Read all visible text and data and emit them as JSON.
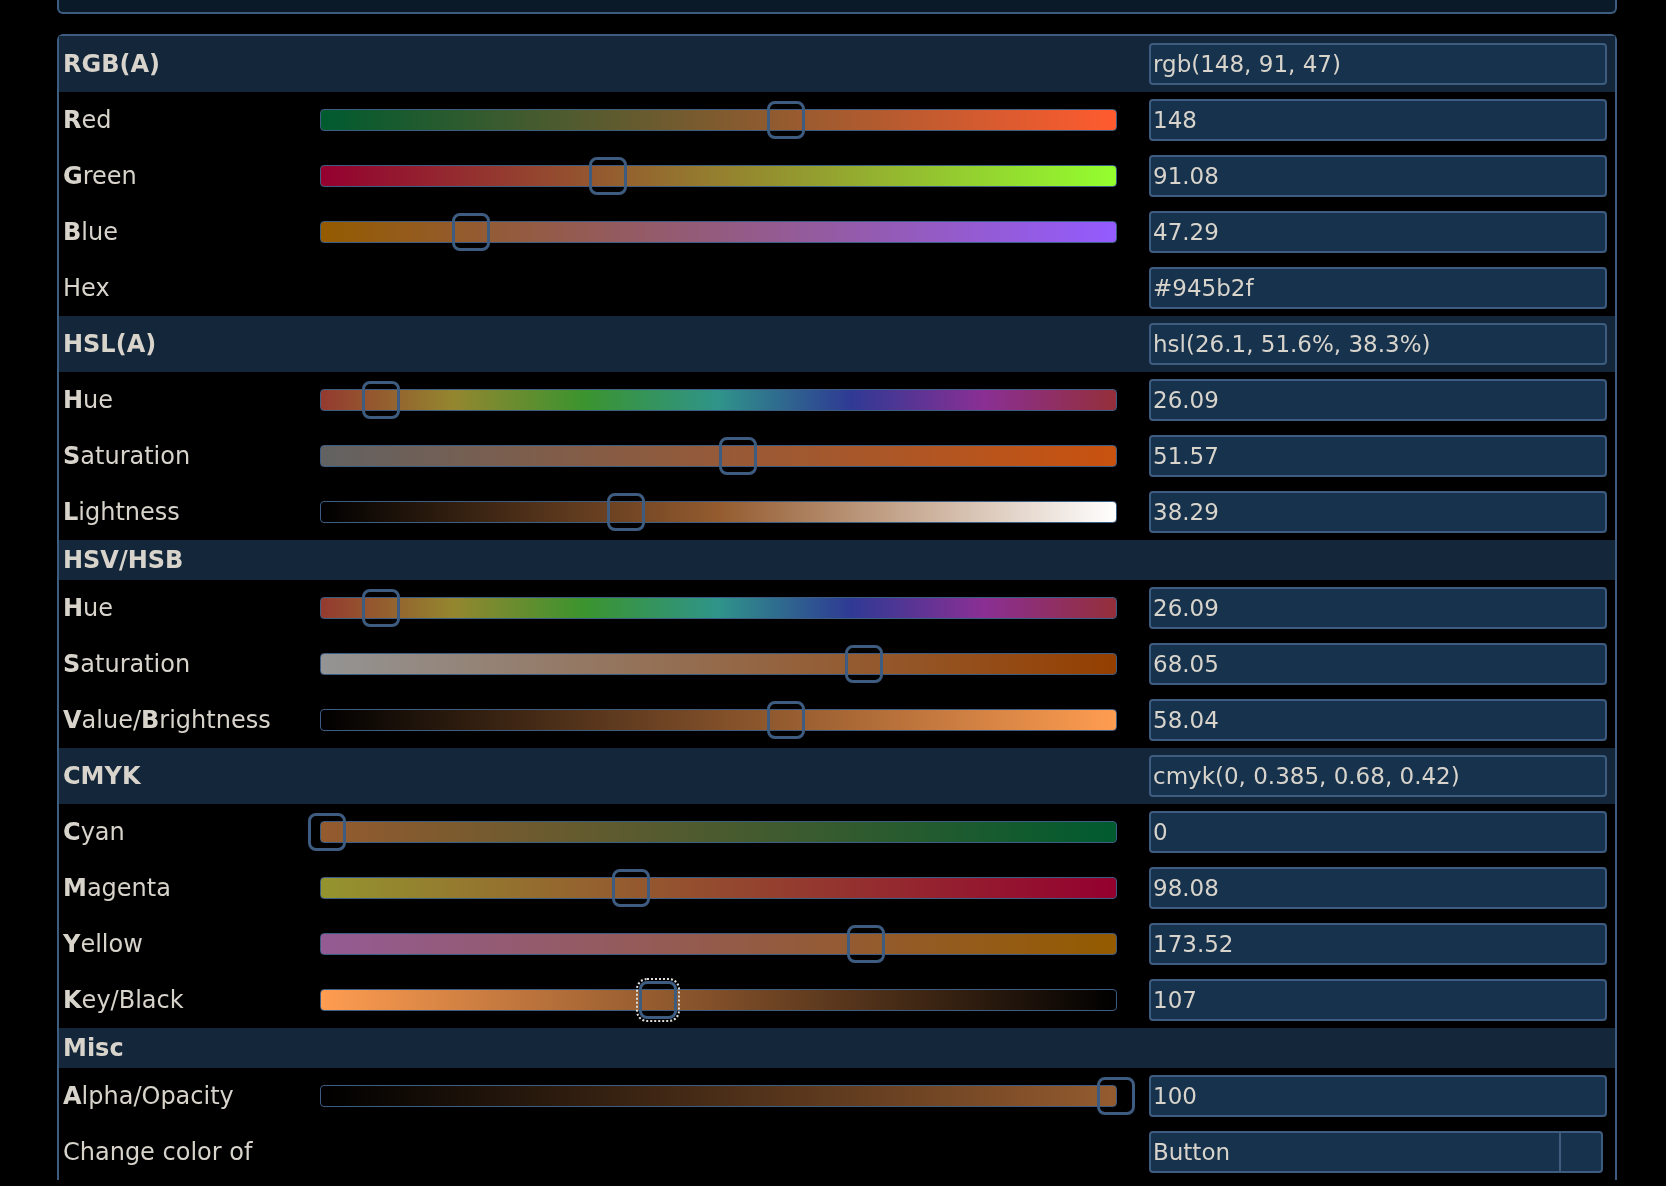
{
  "sections": [
    {
      "title": "RGB(A)",
      "value": "rgb(148, 91, 47)",
      "rows": [
        {
          "kind": "slider",
          "label": "**R**ed",
          "level": 0.585,
          "value": "148",
          "focused": false
        },
        {
          "kind": "slider",
          "label": "**G**reen",
          "level": 0.361,
          "value": "91.08",
          "focused": false
        },
        {
          "kind": "slider",
          "label": "**B**lue",
          "level": 0.189,
          "value": "47.29",
          "focused": false
        },
        {
          "kind": "text",
          "label": "Hex",
          "value": "#945b2f"
        }
      ]
    },
    {
      "title": "HSL(A)",
      "value": "hsl(26.1, 51.6%, 38.3%)",
      "rows": [
        {
          "kind": "slider",
          "label": "**H**ue",
          "level": 0.076,
          "value": "26.09",
          "focused": false
        },
        {
          "kind": "slider",
          "label": "**S**aturation",
          "level": 0.525,
          "value": "51.57",
          "focused": false
        },
        {
          "kind": "slider",
          "label": "**L**ightness",
          "level": 0.384,
          "value": "38.29",
          "focused": false
        }
      ]
    },
    {
      "title": "HSV/HSB",
      "rows": [
        {
          "kind": "slider",
          "label": "**H**ue",
          "level": 0.076,
          "value": "26.09",
          "focused": false
        },
        {
          "kind": "slider",
          "label": "**S**aturation",
          "level": 0.683,
          "value": "68.05",
          "focused": false
        },
        {
          "kind": "slider",
          "label": "**V**alue/**B**rightness",
          "level": 0.585,
          "value": "58.04",
          "focused": false
        }
      ]
    },
    {
      "title": "CMYK",
      "value": "cmyk(0, 0.385, 0.68, 0.42)",
      "rows": [
        {
          "kind": "slider",
          "label": "**C**yan",
          "level": 0.007,
          "value": "0",
          "focused": false
        },
        {
          "kind": "slider",
          "label": "**M**agenta",
          "level": 0.39,
          "value": "98.08",
          "focused": false
        },
        {
          "kind": "slider",
          "label": "**Y**ellow",
          "level": 0.685,
          "value": "173.52",
          "focused": false
        },
        {
          "kind": "slider",
          "label": "**K**ey/Black",
          "level": 0.424,
          "value": "107",
          "focused": true
        }
      ]
    },
    {
      "title": "Misc",
      "rows": [
        {
          "kind": "slider",
          "label": "**A**lpha/Opacity",
          "level": 1.0,
          "value": "100",
          "focused": false
        },
        {
          "kind": "select",
          "label": "Change color of",
          "value": "Button"
        }
      ]
    }
  ]
}
